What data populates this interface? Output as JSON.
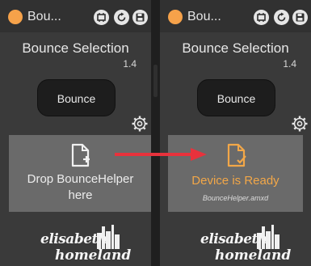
{
  "left": {
    "window_title": "Bou...",
    "heading": "Bounce Selection",
    "version": "1.4",
    "bounce_label": "Bounce",
    "drop_line1": "Drop BounceHelper",
    "drop_line2": "here",
    "logo_line1": "elisabeth",
    "logo_line2": "homeland"
  },
  "right": {
    "window_title": "Bou...",
    "heading": "Bounce Selection",
    "version": "1.4",
    "bounce_label": "Bounce",
    "ready_text": "Device is Ready",
    "file_name": "BounceHelper.amxd",
    "logo_line1": "elisabeth",
    "logo_line2": "homeland"
  },
  "colors": {
    "accent": "#f6a24a",
    "arrow": "#e8323c",
    "panel": "#3a3a3a",
    "dropzone": "#6a6a6a"
  },
  "icons": [
    "device-dot-icon",
    "frame-icon",
    "refresh-icon",
    "save-icon",
    "gear-icon",
    "document-add-icon",
    "document-check-icon",
    "red-arrow"
  ]
}
